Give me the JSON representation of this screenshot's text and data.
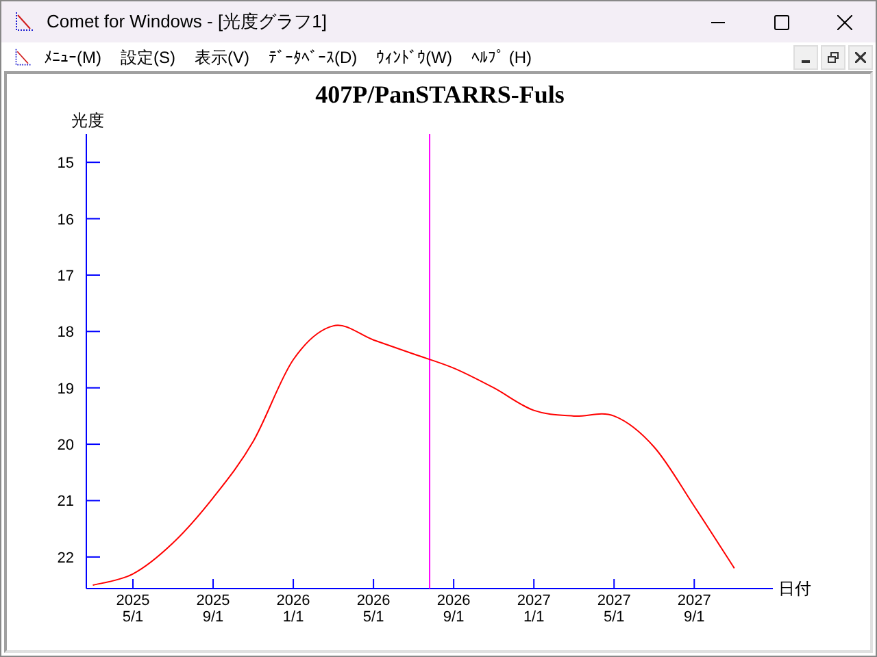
{
  "window": {
    "title": "Comet for Windows - [光度グラフ1]"
  },
  "menu": [
    "ﾒﾆｭｰ(M)",
    "設定(S)",
    "表示(V)",
    "ﾃﾞｰﾀﾍﾞｰｽ(D)",
    "ｳｨﾝﾄﾞｳ(W)",
    "ﾍﾙﾌﾟ (H)"
  ],
  "chart": {
    "chart_data": {
      "type": "line",
      "title": "407P/PanSTARRS-Fuls",
      "xlabel": "日付",
      "ylabel": "光度",
      "categories": [
        null,
        "2025 5/1",
        null,
        "2025 9/1",
        null,
        "2026 1/1",
        null,
        "2026 5/1",
        null,
        "2026 9/1",
        null,
        "2027 1/1",
        null,
        "2027 5/1",
        null,
        "2027 9/1",
        null
      ],
      "series": [
        {
          "color": "#ff0000",
          "values": [
            22.5,
            22.3,
            21.75,
            20.95,
            19.95,
            18.5,
            17.9,
            18.15,
            18.4,
            18.65,
            19.0,
            19.4,
            19.5,
            19.5,
            20.05,
            21.1,
            22.2
          ]
        }
      ],
      "ylim": [
        22.56,
        14.5
      ],
      "yticks": [
        15,
        16,
        17,
        18,
        19,
        20,
        21,
        22
      ]
    }
  }
}
